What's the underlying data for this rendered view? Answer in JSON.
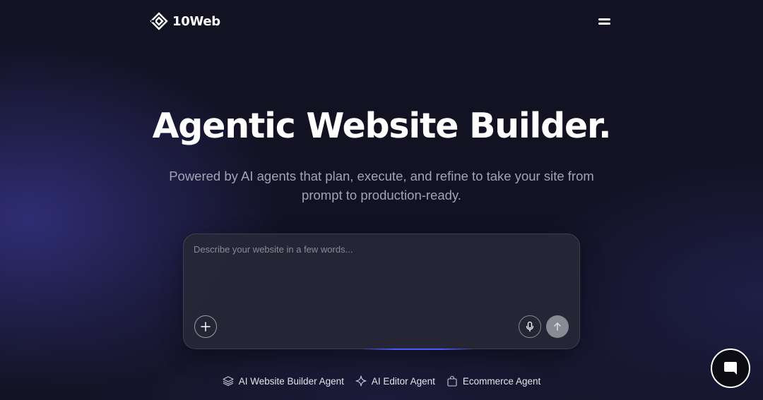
{
  "header": {
    "logo_text": "10Web",
    "logo_icon": "10web-diamond-logo",
    "menu_icon": "hamburger-menu-icon"
  },
  "hero": {
    "title": "Agentic Website Builder.",
    "subtitle": "Powered by AI agents that plan, execute, and refine to take your site from prompt to production-ready."
  },
  "prompt": {
    "placeholder": "Describe your website in a few words...",
    "value": "",
    "add_icon": "plus-icon",
    "mic_icon": "microphone-icon",
    "send_icon": "arrow-up-icon"
  },
  "agents": [
    {
      "label": "AI Website Builder Agent",
      "icon": "layers-icon"
    },
    {
      "label": "AI Editor Agent",
      "icon": "sparkle-icon"
    },
    {
      "label": "Ecommerce Agent",
      "icon": "shopping-bag-icon"
    }
  ],
  "chat": {
    "icon": "chat-bubble-icon"
  },
  "colors": {
    "background": "#121223",
    "accent_glow": "#4f5bff",
    "subtitle_text": "#a3a3b3",
    "send_button": "#8a8a94"
  }
}
